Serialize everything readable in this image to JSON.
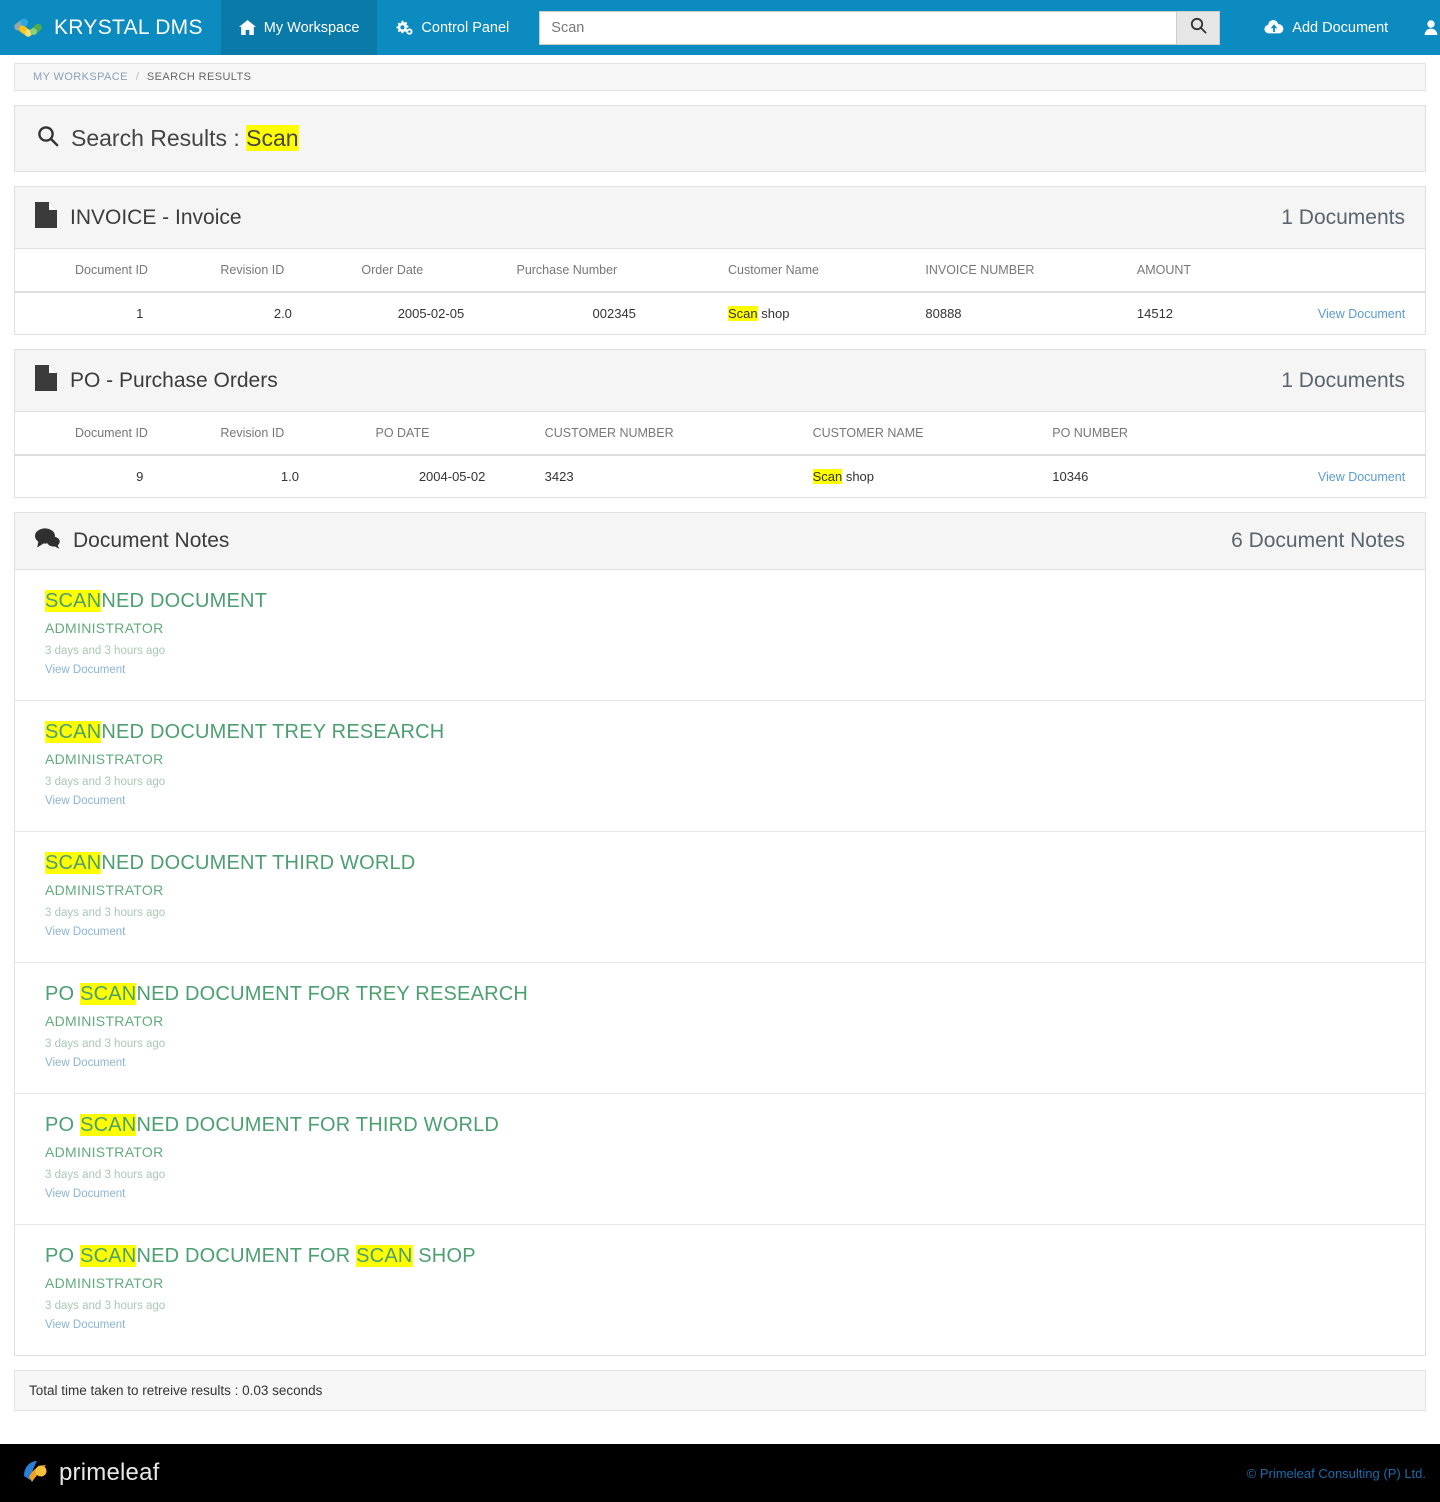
{
  "navbar": {
    "brand": "KRYSTAL DMS",
    "brand_icon": "krystal-logo-icon",
    "items": [
      {
        "label": "My Workspace",
        "icon": "home-icon",
        "active": true
      },
      {
        "label": "Control Panel",
        "icon": "gears-icon",
        "active": false
      }
    ],
    "search": {
      "value": "Scan",
      "placeholder": "Scan",
      "button_icon": "search-icon"
    },
    "add_document": {
      "label": "Add Document",
      "icon": "cloud-upload-icon"
    },
    "user_menu": {
      "icon": "user-icon"
    },
    "help_menu": {
      "icon": "question-circle-icon"
    },
    "bg_color": "#0c8bc0"
  },
  "breadcrumb": {
    "items": [
      "MY WORKSPACE",
      "SEARCH RESULTS"
    ],
    "separator": "/"
  },
  "search_results": {
    "icon": "search-icon",
    "label": "Search Results :",
    "term": "Scan",
    "highlight_color": "#ffff00"
  },
  "sections": [
    {
      "icon": "document-icon",
      "title": "INVOICE - Invoice",
      "count": "1 Documents",
      "columns": [
        "Document ID",
        "Revision ID",
        "Order Date",
        "Purchase Number",
        "Customer Name",
        "INVOICE NUMBER",
        "AMOUNT",
        ""
      ],
      "rows": [
        {
          "cells": [
            "1",
            "2.0",
            "2005-02-05",
            "002345",
            "",
            "80888",
            "14512"
          ],
          "customer_highlight": "Scan",
          "customer_rest": " shop",
          "action": "View Document"
        }
      ]
    },
    {
      "icon": "document-icon",
      "title": "PO - Purchase Orders",
      "count": "1 Documents",
      "columns": [
        "Document ID",
        "Revision ID",
        "PO DATE",
        "CUSTOMER NUMBER",
        "CUSTOMER NAME",
        "PO NUMBER",
        ""
      ],
      "rows": [
        {
          "cells": [
            "9",
            "1.0",
            "2004-05-02",
            "3423",
            "",
            "10346"
          ],
          "customer_highlight": "Scan",
          "customer_rest": " shop",
          "action": "View Document"
        }
      ]
    }
  ],
  "notes_section": {
    "icon": "comments-icon",
    "title": "Document Notes",
    "count": "6 Document Notes",
    "notes": [
      {
        "title_pre": "",
        "title_hl": "SCAN",
        "title_post": "NED DOCUMENT",
        "user": "ADMINISTRATOR",
        "time": "3 days and 3 hours ago",
        "link": "View Document"
      },
      {
        "title_pre": "",
        "title_hl": "SCAN",
        "title_post": "NED DOCUMENT TREY RESEARCH",
        "user": "ADMINISTRATOR",
        "time": "3 days and 3 hours ago",
        "link": "View Document"
      },
      {
        "title_pre": "",
        "title_hl": "SCAN",
        "title_post": "NED DOCUMENT THIRD WORLD",
        "user": "ADMINISTRATOR",
        "time": "3 days and 3 hours ago",
        "link": "View Document"
      },
      {
        "title_pre": "PO ",
        "title_hl": "SCAN",
        "title_post": "NED DOCUMENT FOR TREY RESEARCH",
        "user": "ADMINISTRATOR",
        "time": "3 days and 3 hours ago",
        "link": "View Document"
      },
      {
        "title_pre": "PO ",
        "title_hl": "SCAN",
        "title_post": "NED DOCUMENT FOR THIRD WORLD",
        "user": "ADMINISTRATOR",
        "time": "3 days and 3 hours ago",
        "link": "View Document"
      },
      {
        "title_pre": "PO ",
        "title_hl": "SCAN",
        "title_post": "NED DOCUMENT FOR ",
        "title_hl2": "SCAN",
        "title_post2": " SHOP",
        "user": "ADMINISTRATOR",
        "time": "3 days and 3 hours ago",
        "link": "View Document"
      }
    ]
  },
  "status_bar": {
    "text": "Total time taken to retreive results : 0.03 seconds"
  },
  "footer": {
    "brand": "primeleaf",
    "brand_icon": "primeleaf-logo-icon",
    "copyright": "© Primeleaf Consulting (P) Ltd.",
    "copyright_color": "#1b6ca8",
    "bg_color": "#000000"
  }
}
